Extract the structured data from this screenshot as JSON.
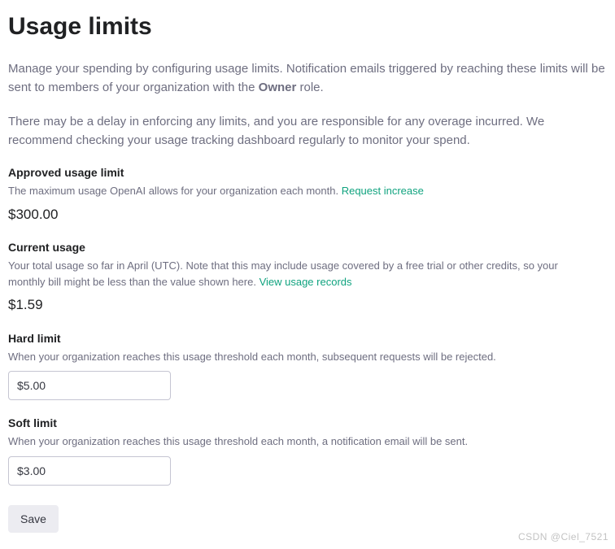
{
  "header": {
    "title": "Usage limits"
  },
  "description": {
    "para1_pre": "Manage your spending by configuring usage limits. Notification emails triggered by reaching these limits will be sent to members of your organization with the ",
    "para1_bold": "Owner",
    "para1_post": " role.",
    "para2": "There may be a delay in enforcing any limits, and you are responsible for any overage incurred. We recommend checking your usage tracking dashboard regularly to monitor your spend."
  },
  "approved": {
    "title": "Approved usage limit",
    "subtitle": "The maximum usage OpenAI allows for your organization each month. ",
    "link": "Request increase",
    "value": "$300.00"
  },
  "current": {
    "title": "Current usage",
    "subtitle": "Your total usage so far in April (UTC). Note that this may include usage covered by a free trial or other credits, so your monthly bill might be less than the value shown here. ",
    "link": "View usage records",
    "value": "$1.59"
  },
  "hard": {
    "title": "Hard limit",
    "subtitle": "When your organization reaches this usage threshold each month, subsequent requests will be rejected.",
    "value": "$5.00"
  },
  "soft": {
    "title": "Soft limit",
    "subtitle": "When your organization reaches this usage threshold each month, a notification email will be sent.",
    "value": "$3.00"
  },
  "actions": {
    "save": "Save"
  },
  "watermark": "CSDN @Ciel_7521"
}
